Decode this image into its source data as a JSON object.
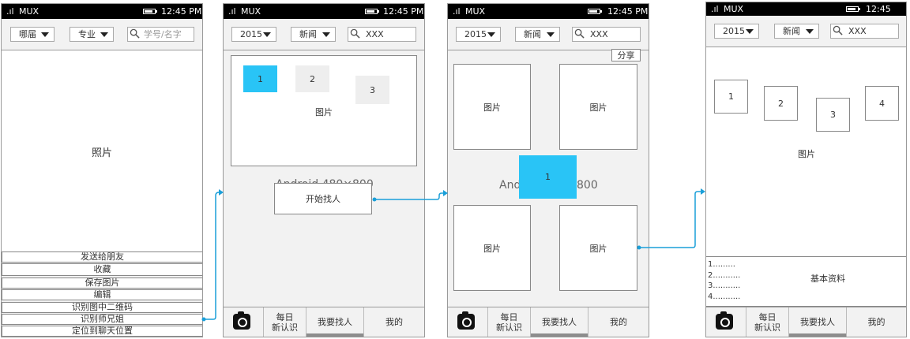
{
  "status_bar": {
    "carrier": "MUX",
    "time": "12:45 PM",
    "signal_glyph": ".ıl"
  },
  "screen1": {
    "filters": {
      "school": "哪届",
      "major": "专业"
    },
    "search_placeholder": "学号/名字",
    "photo_label": "照片",
    "menu": [
      "发送给朋友",
      "收藏",
      "保存图片",
      "编辑",
      "识别图中二维码",
      "识别师兄姐",
      "定位到聊天位置"
    ]
  },
  "screen2": {
    "filters": {
      "year": "2015",
      "category": "新闻"
    },
    "search_value": "XXX",
    "carousel_items": [
      "1",
      "2",
      "3"
    ],
    "image_label": "图片",
    "bg_text": "Android 480×800",
    "start_button": "开始找人"
  },
  "screen3": {
    "filters": {
      "year": "2015",
      "category": "新闻"
    },
    "search_value": "XXX",
    "share_button": "分享",
    "cards": [
      "图片",
      "图片",
      "图片",
      "图片"
    ],
    "bg_text_left": "And",
    "bg_text_right": "800",
    "floating_card": "1"
  },
  "screen4": {
    "filters": {
      "year": "2015",
      "category": "新闻"
    },
    "search_value": "XXX",
    "items": [
      "1",
      "2",
      "3",
      "4"
    ],
    "image_label": "图片",
    "list_lines": [
      "1.........",
      "2...........",
      "3...........",
      "4..........."
    ],
    "basic_info": "基本资料"
  },
  "tabbar": {
    "tabs": [
      {
        "label_line1": "每日",
        "label_line2": "新认识"
      },
      {
        "label": "我要找人"
      },
      {
        "label": "我的"
      }
    ]
  },
  "colors": {
    "accent_blue": "#29c4f6",
    "arrow_blue": "#1a9fd9"
  }
}
